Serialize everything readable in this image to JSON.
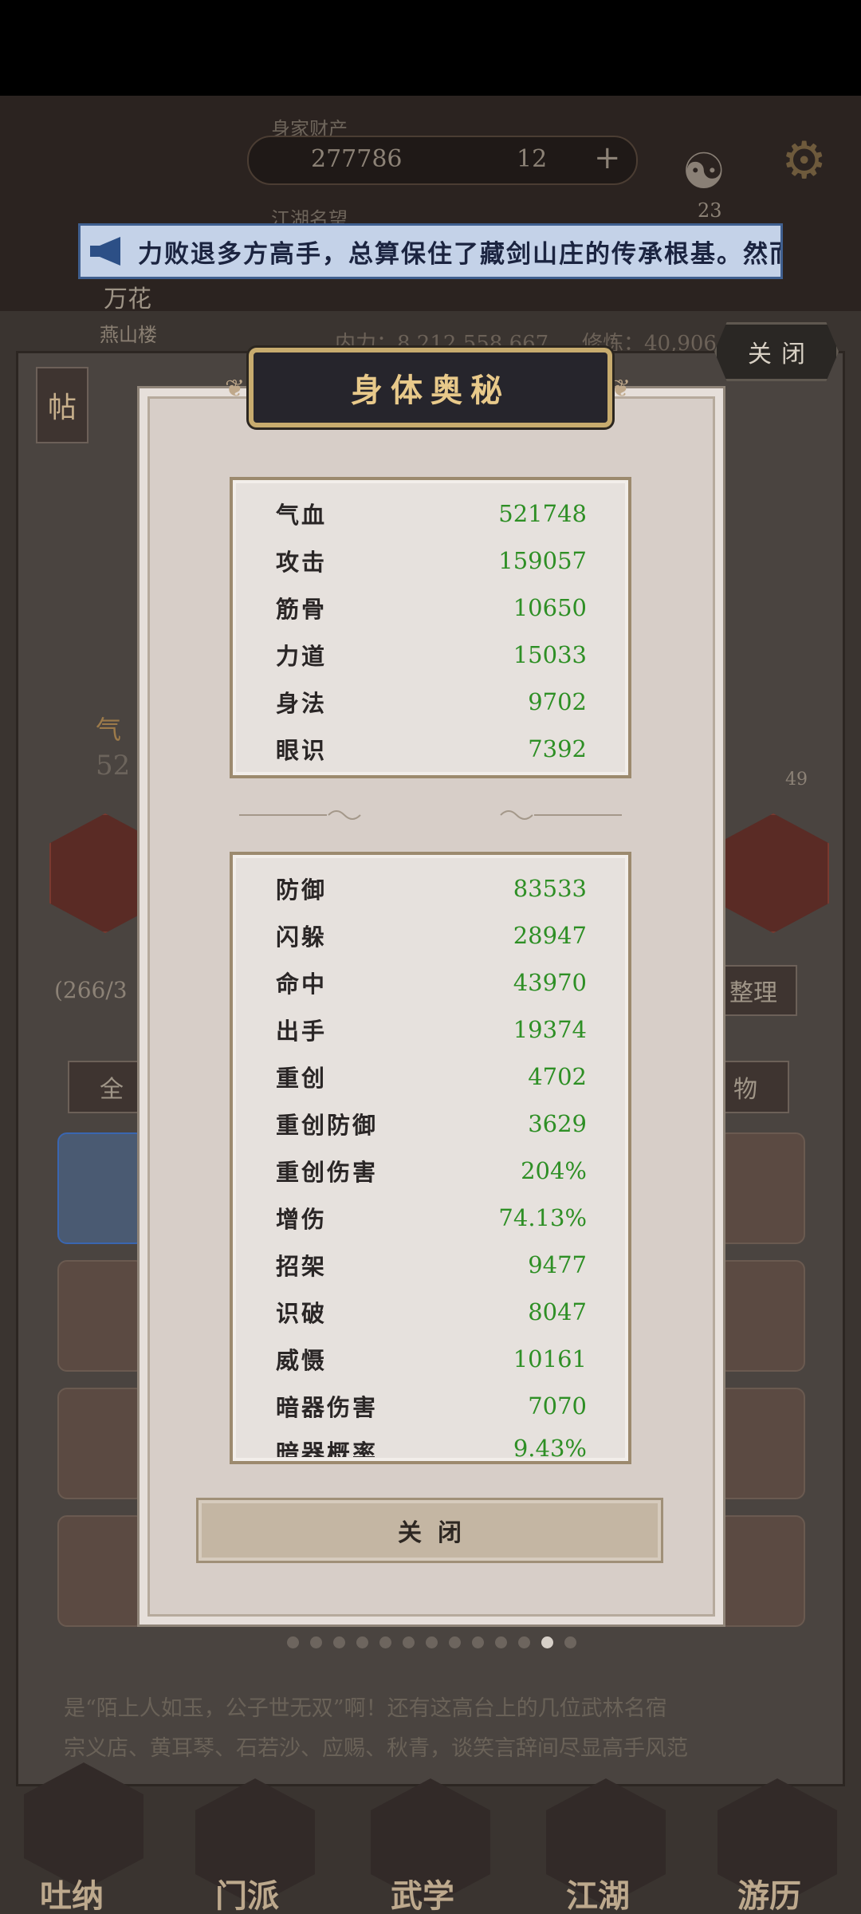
{
  "background": {
    "resources_label": "身家财产",
    "gold_amount": "277786",
    "gem_amount": "12",
    "notify_count": "23",
    "jianghu_label": "江湖名望",
    "char_name": "万花",
    "char_title": "燕山楼",
    "power_text": "内力：8,212,558,667",
    "stat_text": "修炼：40,906",
    "post_label": "帖",
    "counter_text": "(266/3",
    "sort_label": "整理",
    "tab_all": "全",
    "tab_item": "物",
    "hp_short": "气",
    "hp_short_val": "52",
    "level_badge": "49",
    "chat_line_1": "是“陌上人如玉，公子世无双”啊！还有这高台上的几位武林名宿",
    "chat_line_2": "宗义店、黄耳琴、石若沙、应赐、秋青，谈笑言辞间尽显高手风范",
    "nav": [
      "吐纳",
      "门派",
      "武学",
      "江湖",
      "游历"
    ]
  },
  "marquee": {
    "text": "力败退多方高手，总算保住了藏剑山庄的传承根基。然而"
  },
  "top_close_label": "关闭",
  "modal": {
    "title": "身体奥秘",
    "basic_stats": [
      {
        "label": "气血",
        "value": "521748"
      },
      {
        "label": "攻击",
        "value": "159057"
      },
      {
        "label": "筋骨",
        "value": "10650"
      },
      {
        "label": "力道",
        "value": "15033"
      },
      {
        "label": "身法",
        "value": "9702"
      },
      {
        "label": "眼识",
        "value": "7392"
      }
    ],
    "combat_stats": [
      {
        "label": "防御",
        "value": "83533"
      },
      {
        "label": "闪躲",
        "value": "28947"
      },
      {
        "label": "命中",
        "value": "43970"
      },
      {
        "label": "出手",
        "value": "19374"
      },
      {
        "label": "重创",
        "value": "4702"
      },
      {
        "label": "重创防御",
        "value": "3629"
      },
      {
        "label": "重创伤害",
        "value": "204%"
      },
      {
        "label": "增伤",
        "value": "74.13%"
      },
      {
        "label": "招架",
        "value": "9477"
      },
      {
        "label": "识破",
        "value": "8047"
      },
      {
        "label": "威慑",
        "value": "10161"
      },
      {
        "label": "暗器伤害",
        "value": "7070"
      },
      {
        "label": "暗器概率",
        "value": "9.43%"
      }
    ],
    "close_label": "关闭"
  },
  "pager": {
    "total": 13,
    "active_index": 11
  },
  "colors": {
    "stat_value": "#2e8f25",
    "title_gold": "#e8c98a",
    "marquee_bg": "#c4d2e8"
  }
}
